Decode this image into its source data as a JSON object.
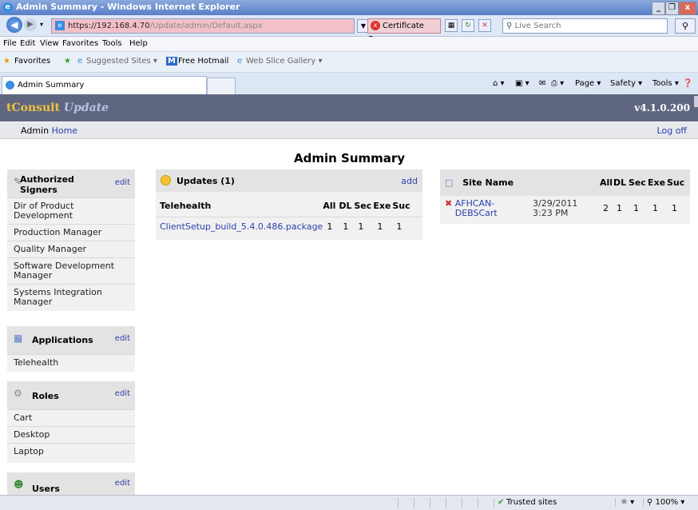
{
  "window": {
    "title": "Admin Summary - Windows Internet Explorer",
    "controls": {
      "minimize": "_",
      "restore": "❐",
      "close": "x"
    }
  },
  "address": {
    "host": "https://192.168.4.70",
    "path": "/Update/admin/Default.aspx",
    "cert_error": "Certificate Error",
    "search_placeholder": "Live Search"
  },
  "menu": [
    "File",
    "Edit",
    "View",
    "Favorites",
    "Tools",
    "Help"
  ],
  "favorites_bar": {
    "favorites": "Favorites",
    "suggested": "Suggested Sites ▾",
    "hotmail": "Free Hotmail",
    "webslice": "Web Slice Gallery ▾"
  },
  "tab": {
    "title": "Admin Summary"
  },
  "commands": {
    "page": "Page ▾",
    "safety": "Safety ▾",
    "tools": "Tools ▾"
  },
  "app": {
    "brand": "tConsult",
    "brand_suffix": "Update",
    "version": "v4.1.0.200",
    "nav_admin": "Admin",
    "nav_home": "Home",
    "logoff": "Log off",
    "page_title": "Admin Summary"
  },
  "sidebar": {
    "signers": {
      "title": "Authorized Signers",
      "edit": "edit",
      "items": [
        "Dir of Product Development",
        "Production Manager",
        "Quality Manager",
        "Software Development Manager",
        "Systems Integration Manager"
      ]
    },
    "applications": {
      "title": "Applications",
      "edit": "edit",
      "items": [
        "Telehealth"
      ]
    },
    "roles": {
      "title": "Roles",
      "edit": "edit",
      "items": [
        "Cart",
        "Desktop",
        "Laptop"
      ]
    },
    "users": {
      "title": "Users",
      "edit": "edit"
    }
  },
  "updates": {
    "title": "Updates (1)",
    "add": "add",
    "app_header": "Telehealth",
    "columns": [
      "All",
      "DL",
      "Sec",
      "Exe",
      "Suc"
    ],
    "rows": [
      {
        "name": "ClientSetup_build_5.4.0.486.package",
        "values": [
          "1",
          "1",
          "1",
          "1",
          "1"
        ]
      }
    ]
  },
  "sites": {
    "header": "Site Name",
    "columns": [
      "All",
      "DL",
      "Sec",
      "Exe",
      "Suc"
    ],
    "rows": [
      {
        "marker": "✖",
        "name": "AFHCAN-DEBSCart",
        "date": "3/29/2011",
        "time": "3:23 PM",
        "values": [
          "2",
          "1",
          "1",
          "1",
          "1"
        ]
      }
    ]
  },
  "status": {
    "zone": "Trusted sites",
    "zoom": "100%"
  }
}
